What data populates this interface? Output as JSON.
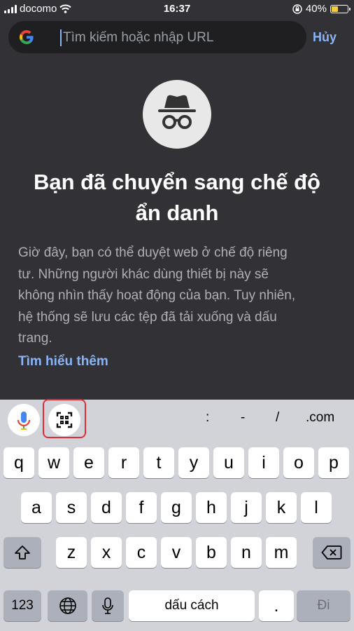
{
  "status_bar": {
    "carrier": "docomo",
    "time": "16:37",
    "battery_percent": "40%"
  },
  "url_bar": {
    "placeholder": "Tìm kiếm hoặc nhập URL",
    "cancel_label": "Hủy"
  },
  "incognito": {
    "title_line1": "Bạn đã chuyển sang chế độ",
    "title_line2": "ẩn danh",
    "description_lines": [
      "Giờ đây, bạn có thể duyệt web ở chế độ riêng",
      "tư. Những người khác dùng thiết bị này sẽ",
      "không nhìn thấy hoạt động của bạn. Tuy nhiên,",
      "hệ thống sẽ lưu các tệp đã tải xuống và dấu",
      "trang."
    ],
    "learn_more": "Tìm hiểu thêm"
  },
  "keyboard": {
    "suggestions": [
      ":",
      "-",
      "/",
      ".com"
    ],
    "row1": [
      "q",
      "w",
      "e",
      "r",
      "t",
      "y",
      "u",
      "i",
      "o",
      "p"
    ],
    "row2": [
      "a",
      "s",
      "d",
      "f",
      "g",
      "h",
      "j",
      "k",
      "l"
    ],
    "row3": [
      "z",
      "x",
      "c",
      "v",
      "b",
      "n",
      "m"
    ],
    "numbers_key": "123",
    "space_key": "dấu cách",
    "period_key": ".",
    "go_key": "Đi"
  },
  "colors": {
    "accent": "#8ab4f8",
    "highlight_box": "#e32b36",
    "page_bg": "#323236"
  }
}
